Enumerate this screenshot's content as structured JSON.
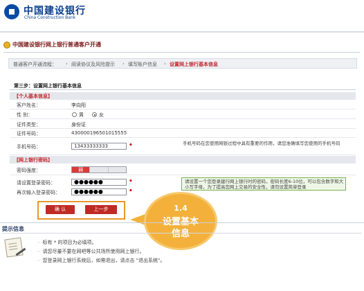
{
  "brand": {
    "name_cn": "中国建设银行",
    "name_en": "China Construction Bank"
  },
  "page_title": "中国建设银行网上银行普通客户开通",
  "steps": {
    "prefix": "普通客户开通流程：",
    "items": [
      "阅读协议及风险提示",
      "填写账户信息",
      "设置网上银行基本信息"
    ],
    "active_index": 2
  },
  "form": {
    "section_title": "第三步：设置网上银行基本信息",
    "personal": {
      "header": "【个人基本信息】",
      "rows": [
        {
          "label": "客户姓名：",
          "value": "李向阳"
        },
        {
          "label": "性    别：",
          "options": [
            "男",
            "女"
          ],
          "selected": "女"
        },
        {
          "label": "证件类型：",
          "value": "身份证"
        },
        {
          "label": "证件号码：",
          "value": "430000196501015555"
        }
      ],
      "phone": {
        "label": "手机号码：",
        "value": "13433333333",
        "note": "手机号码在您使用网银过程中具有重要的作用，请您准确填写您使用的手机号码"
      }
    },
    "password": {
      "header": "【网上银行密码】",
      "strength_label": "密码强度：",
      "strength_value": "弱",
      "login_label": "请设置登录密码：",
      "login_value": "●●●●●●",
      "confirm_label": "再次输入登录密码：",
      "confirm_value": "●●●●●●",
      "tip": "请设置一个您登录建行网上银行时的密码，密码长度6-10位，可以包含数字和大小写字母，为了提高您网上交易的安全性，请勿设置简单登录"
    },
    "buttons": {
      "confirm": "确   认",
      "back": "上一步"
    }
  },
  "callout": {
    "step": "1.4",
    "text": "设置基本信息"
  },
  "tips": {
    "title": "提示信息",
    "items": [
      "标有 * 的项目为必填项。",
      "请您尽量不要在网吧等公共场所使用网上银行。",
      "您登录网上银行系统后，如需退出，请点击 \"退出系统\"。"
    ]
  },
  "colors": {
    "accent_red": "#c1272d",
    "brand_blue": "#0a3f8f",
    "callout": "#f3b13c"
  }
}
